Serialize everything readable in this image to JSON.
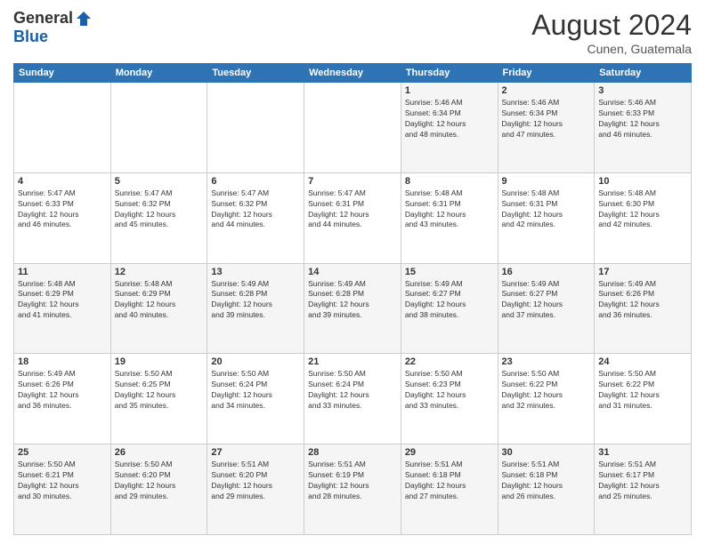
{
  "header": {
    "logo_general": "General",
    "logo_blue": "Blue",
    "month_title": "August 2024",
    "location": "Cunen, Guatemala"
  },
  "days_of_week": [
    "Sunday",
    "Monday",
    "Tuesday",
    "Wednesday",
    "Thursday",
    "Friday",
    "Saturday"
  ],
  "weeks": [
    [
      {
        "day": "",
        "info": ""
      },
      {
        "day": "",
        "info": ""
      },
      {
        "day": "",
        "info": ""
      },
      {
        "day": "",
        "info": ""
      },
      {
        "day": "1",
        "info": "Sunrise: 5:46 AM\nSunset: 6:34 PM\nDaylight: 12 hours\nand 48 minutes."
      },
      {
        "day": "2",
        "info": "Sunrise: 5:46 AM\nSunset: 6:34 PM\nDaylight: 12 hours\nand 47 minutes."
      },
      {
        "day": "3",
        "info": "Sunrise: 5:46 AM\nSunset: 6:33 PM\nDaylight: 12 hours\nand 46 minutes."
      }
    ],
    [
      {
        "day": "4",
        "info": "Sunrise: 5:47 AM\nSunset: 6:33 PM\nDaylight: 12 hours\nand 46 minutes."
      },
      {
        "day": "5",
        "info": "Sunrise: 5:47 AM\nSunset: 6:32 PM\nDaylight: 12 hours\nand 45 minutes."
      },
      {
        "day": "6",
        "info": "Sunrise: 5:47 AM\nSunset: 6:32 PM\nDaylight: 12 hours\nand 44 minutes."
      },
      {
        "day": "7",
        "info": "Sunrise: 5:47 AM\nSunset: 6:31 PM\nDaylight: 12 hours\nand 44 minutes."
      },
      {
        "day": "8",
        "info": "Sunrise: 5:48 AM\nSunset: 6:31 PM\nDaylight: 12 hours\nand 43 minutes."
      },
      {
        "day": "9",
        "info": "Sunrise: 5:48 AM\nSunset: 6:31 PM\nDaylight: 12 hours\nand 42 minutes."
      },
      {
        "day": "10",
        "info": "Sunrise: 5:48 AM\nSunset: 6:30 PM\nDaylight: 12 hours\nand 42 minutes."
      }
    ],
    [
      {
        "day": "11",
        "info": "Sunrise: 5:48 AM\nSunset: 6:29 PM\nDaylight: 12 hours\nand 41 minutes."
      },
      {
        "day": "12",
        "info": "Sunrise: 5:48 AM\nSunset: 6:29 PM\nDaylight: 12 hours\nand 40 minutes."
      },
      {
        "day": "13",
        "info": "Sunrise: 5:49 AM\nSunset: 6:28 PM\nDaylight: 12 hours\nand 39 minutes."
      },
      {
        "day": "14",
        "info": "Sunrise: 5:49 AM\nSunset: 6:28 PM\nDaylight: 12 hours\nand 39 minutes."
      },
      {
        "day": "15",
        "info": "Sunrise: 5:49 AM\nSunset: 6:27 PM\nDaylight: 12 hours\nand 38 minutes."
      },
      {
        "day": "16",
        "info": "Sunrise: 5:49 AM\nSunset: 6:27 PM\nDaylight: 12 hours\nand 37 minutes."
      },
      {
        "day": "17",
        "info": "Sunrise: 5:49 AM\nSunset: 6:26 PM\nDaylight: 12 hours\nand 36 minutes."
      }
    ],
    [
      {
        "day": "18",
        "info": "Sunrise: 5:49 AM\nSunset: 6:26 PM\nDaylight: 12 hours\nand 36 minutes."
      },
      {
        "day": "19",
        "info": "Sunrise: 5:50 AM\nSunset: 6:25 PM\nDaylight: 12 hours\nand 35 minutes."
      },
      {
        "day": "20",
        "info": "Sunrise: 5:50 AM\nSunset: 6:24 PM\nDaylight: 12 hours\nand 34 minutes."
      },
      {
        "day": "21",
        "info": "Sunrise: 5:50 AM\nSunset: 6:24 PM\nDaylight: 12 hours\nand 33 minutes."
      },
      {
        "day": "22",
        "info": "Sunrise: 5:50 AM\nSunset: 6:23 PM\nDaylight: 12 hours\nand 33 minutes."
      },
      {
        "day": "23",
        "info": "Sunrise: 5:50 AM\nSunset: 6:22 PM\nDaylight: 12 hours\nand 32 minutes."
      },
      {
        "day": "24",
        "info": "Sunrise: 5:50 AM\nSunset: 6:22 PM\nDaylight: 12 hours\nand 31 minutes."
      }
    ],
    [
      {
        "day": "25",
        "info": "Sunrise: 5:50 AM\nSunset: 6:21 PM\nDaylight: 12 hours\nand 30 minutes."
      },
      {
        "day": "26",
        "info": "Sunrise: 5:50 AM\nSunset: 6:20 PM\nDaylight: 12 hours\nand 29 minutes."
      },
      {
        "day": "27",
        "info": "Sunrise: 5:51 AM\nSunset: 6:20 PM\nDaylight: 12 hours\nand 29 minutes."
      },
      {
        "day": "28",
        "info": "Sunrise: 5:51 AM\nSunset: 6:19 PM\nDaylight: 12 hours\nand 28 minutes."
      },
      {
        "day": "29",
        "info": "Sunrise: 5:51 AM\nSunset: 6:18 PM\nDaylight: 12 hours\nand 27 minutes."
      },
      {
        "day": "30",
        "info": "Sunrise: 5:51 AM\nSunset: 6:18 PM\nDaylight: 12 hours\nand 26 minutes."
      },
      {
        "day": "31",
        "info": "Sunrise: 5:51 AM\nSunset: 6:17 PM\nDaylight: 12 hours\nand 25 minutes."
      }
    ]
  ]
}
